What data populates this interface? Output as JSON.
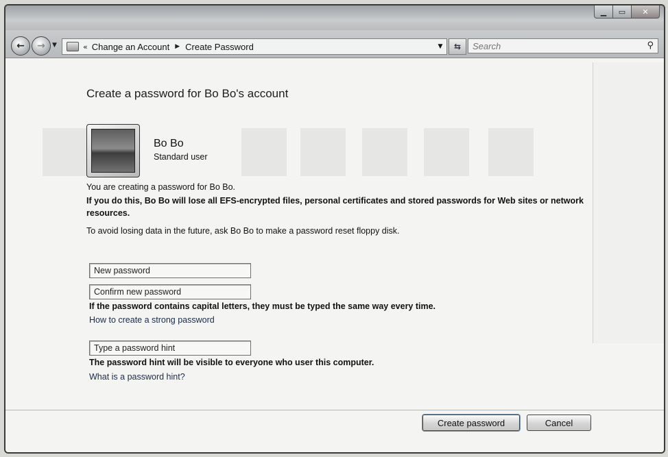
{
  "navigation": {
    "back_glyph": "←",
    "forward_glyph": "→",
    "breadcrumb": [
      "Change an Account",
      "Create Password"
    ]
  },
  "search": {
    "placeholder": "Search"
  },
  "page": {
    "heading": "Create a password for Bo Bo's account",
    "user_name": "Bo Bo",
    "user_type": "Standard user",
    "info_line": "You are creating a password for Bo Bo.",
    "warning": "If you do this, Bo Bo will lose all EFS-encrypted files, personal certificates and stored passwords for Web sites or network resources.",
    "advice": "To avoid losing data in the future, ask Bo Bo to make a password reset floppy disk."
  },
  "form": {
    "new_password_placeholder": "New password",
    "confirm_password_placeholder": "Confirm new password",
    "caps_note": "If the password contains capital letters, they must be typed the same way every time.",
    "strong_password_link": "How to create a strong password",
    "hint_placeholder": "Type a password hint",
    "hint_note": "The password hint will be visible to everyone who user this computer.",
    "hint_link": "What is a password hint?"
  },
  "buttons": {
    "create": "Create password",
    "cancel": "Cancel"
  },
  "colors": {
    "link": "#1a2a4a",
    "window_frame": "#3a3a3a"
  }
}
